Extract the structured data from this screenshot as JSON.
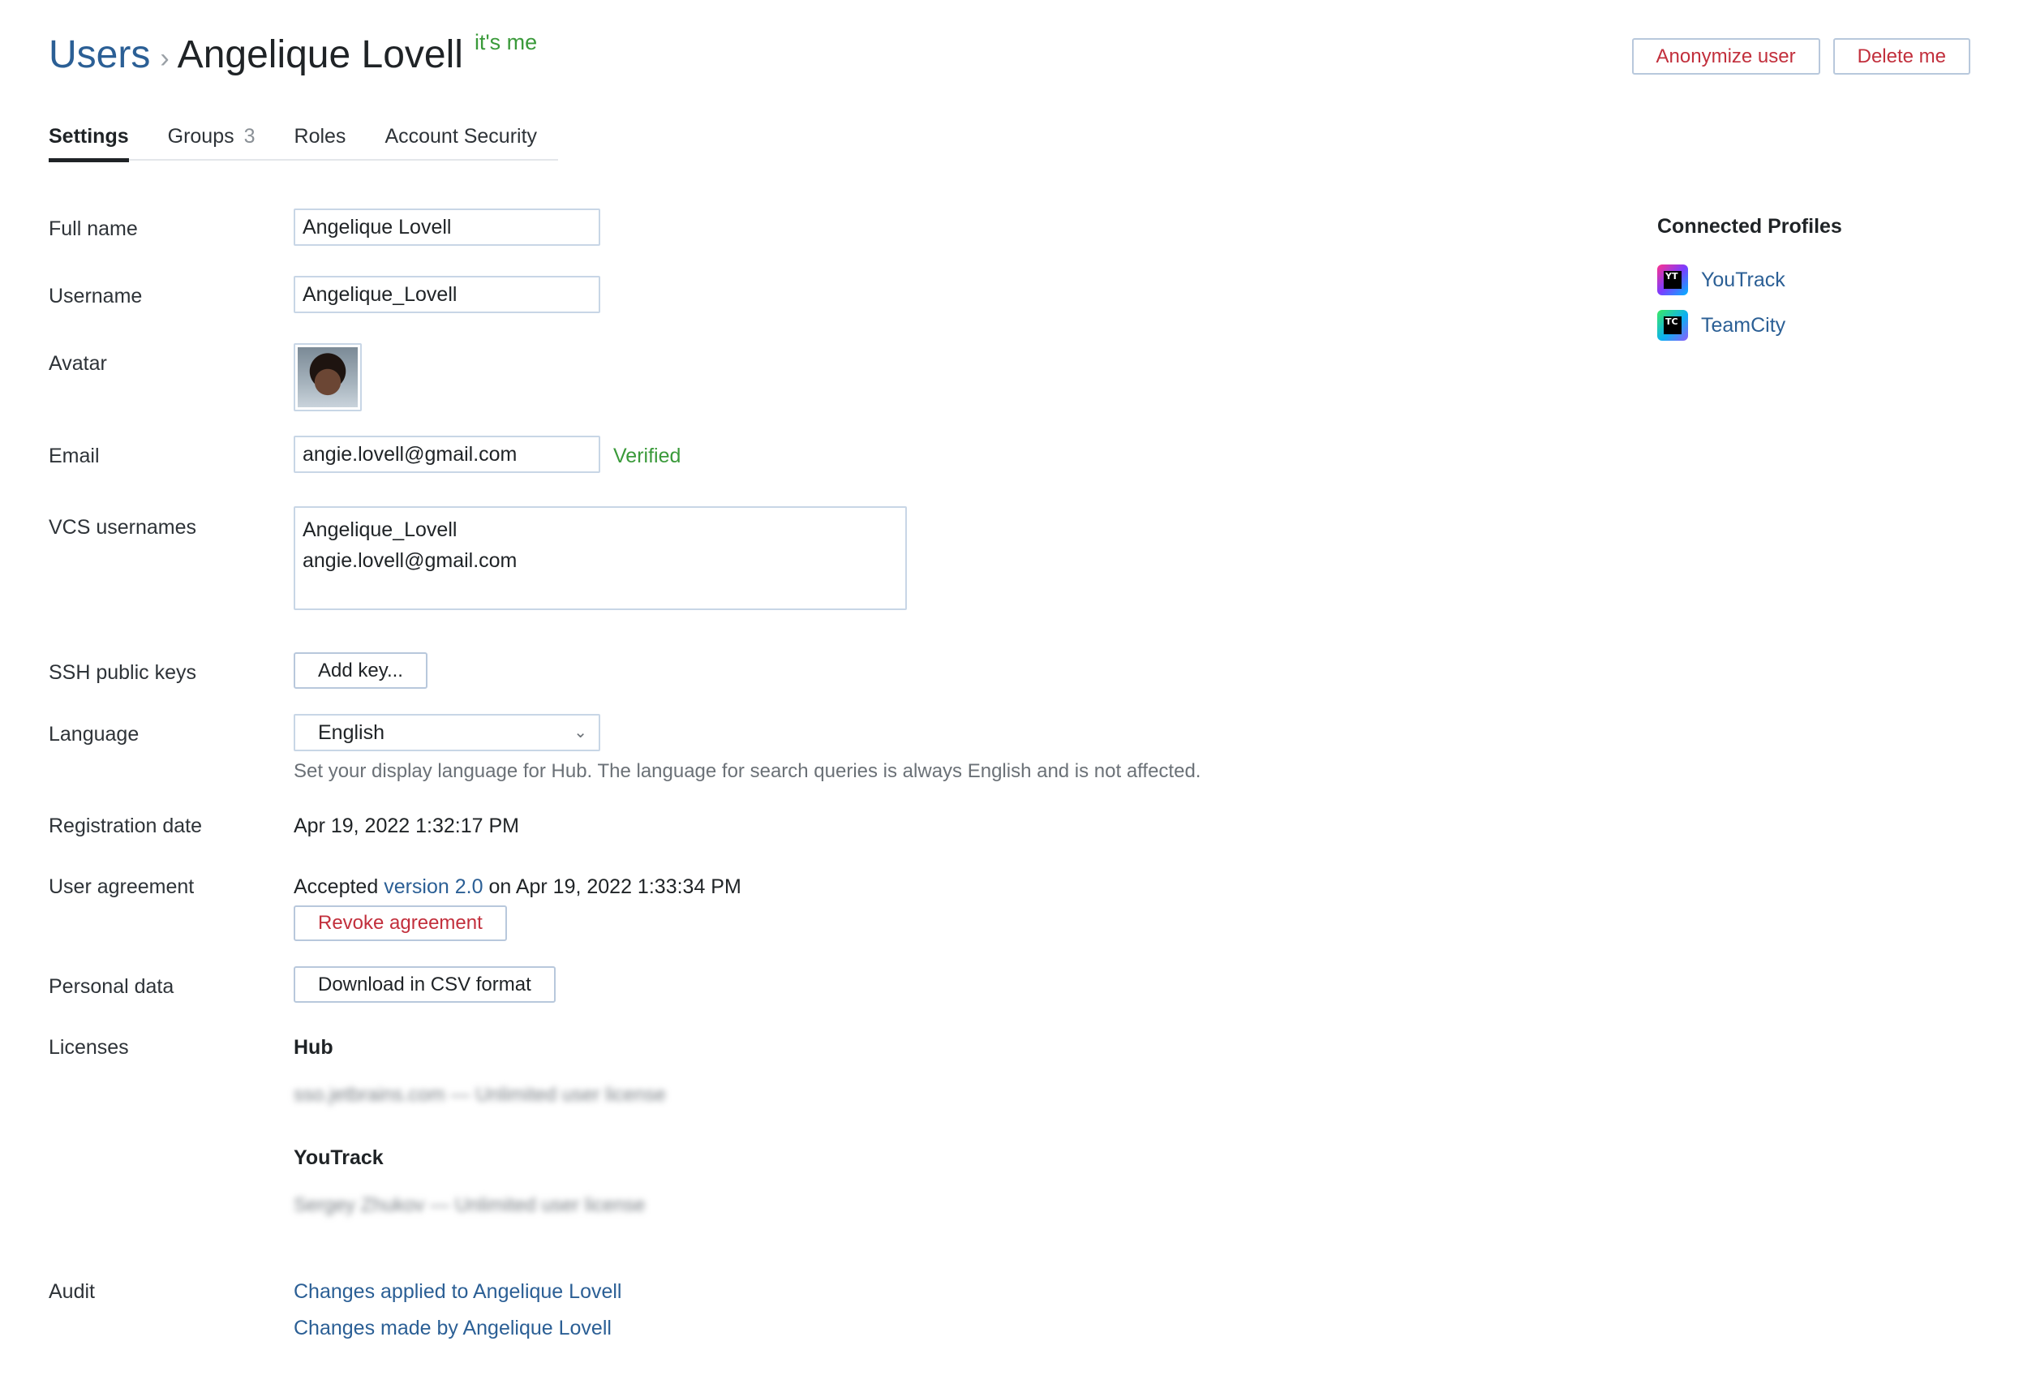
{
  "breadcrumb": {
    "users": "Users",
    "separator": "›",
    "name": "Angelique Lovell",
    "its_me": "it's me"
  },
  "header_actions": {
    "anonymize": "Anonymize user",
    "delete": "Delete me"
  },
  "tabs": [
    {
      "label": "Settings",
      "count": ""
    },
    {
      "label": "Groups",
      "count": "3"
    },
    {
      "label": "Roles",
      "count": ""
    },
    {
      "label": "Account Security",
      "count": ""
    }
  ],
  "form": {
    "full_name": {
      "label": "Full name",
      "value": "Angelique Lovell"
    },
    "username": {
      "label": "Username",
      "value": "Angelique_Lovell"
    },
    "avatar": {
      "label": "Avatar"
    },
    "email": {
      "label": "Email",
      "value": "angie.lovell@gmail.com",
      "status": "Verified"
    },
    "vcs": {
      "label": "VCS usernames",
      "value": "Angelique_Lovell\nangie.lovell@gmail.com"
    },
    "ssh": {
      "label": "SSH public keys",
      "button": "Add key..."
    },
    "language": {
      "label": "Language",
      "value": "English",
      "hint": "Set your display language for Hub. The language for search queries is always English and is not affected."
    },
    "registration": {
      "label": "Registration date",
      "value": "Apr 19, 2022 1:32:17 PM"
    },
    "agreement": {
      "label": "User agreement",
      "prefix": "Accepted",
      "version_link": "version 2.0",
      "suffix": "on Apr 19, 2022 1:33:34 PM",
      "revoke": "Revoke agreement"
    },
    "personal_data": {
      "label": "Personal data",
      "button": "Download in CSV format"
    },
    "licenses": {
      "label": "Licenses",
      "hub_title": "Hub",
      "hub_detail": "sso.jetbrains.com — Unlimited user license",
      "yt_title": "YouTrack",
      "yt_detail": "Sergey Zhukov — Unlimited user license"
    },
    "audit": {
      "label": "Audit",
      "applied": "Changes applied to Angelique Lovell",
      "made": "Changes made by Angelique Lovell"
    }
  },
  "connected_profiles": {
    "title": "Connected Profiles",
    "items": [
      {
        "name": "YouTrack",
        "icon_text": "YT",
        "icon": "youtrack-icon"
      },
      {
        "name": "TeamCity",
        "icon_text": "TC",
        "icon": "teamcity-icon"
      }
    ]
  },
  "colors": {
    "link": "#2b5f95",
    "danger": "#c22f3c",
    "success": "#3a9a3a",
    "border": "#c8d6e6"
  }
}
